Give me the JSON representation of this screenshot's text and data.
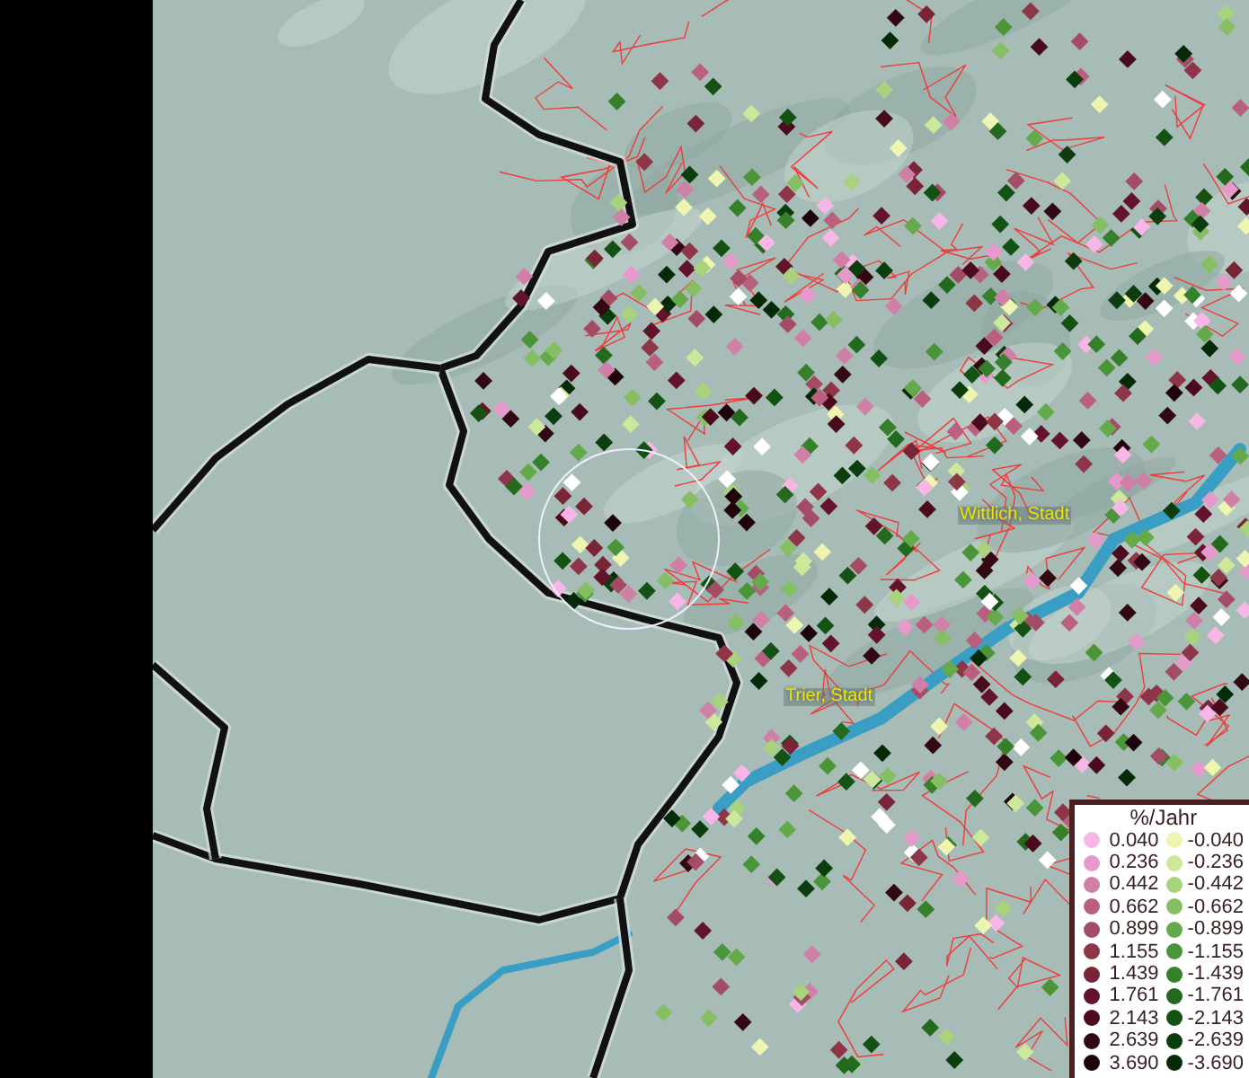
{
  "map": {
    "places": [
      {
        "label": "Wittlich, Stadt",
        "kind": "town"
      },
      {
        "label": "Trier, Stadt",
        "kind": "town"
      }
    ],
    "highlight": {
      "kind": "circle"
    }
  },
  "legend": {
    "title": "%/Jahr",
    "positive": [
      {
        "value": "0.040",
        "color": "#f7b6e6"
      },
      {
        "value": "0.236",
        "color": "#e59acb"
      },
      {
        "value": "0.442",
        "color": "#d07fa6"
      },
      {
        "value": "0.662",
        "color": "#b9607f"
      },
      {
        "value": "0.899",
        "color": "#a44b66"
      },
      {
        "value": "1.155",
        "color": "#8e3548"
      },
      {
        "value": "1.439",
        "color": "#7a2438"
      },
      {
        "value": "1.761",
        "color": "#63142a"
      },
      {
        "value": "2.143",
        "color": "#4a0c1c"
      },
      {
        "value": "2.639",
        "color": "#320812"
      },
      {
        "value": "3.690",
        "color": "#1e040a"
      }
    ],
    "negative": [
      {
        "value": "-0.040",
        "color": "#eef5b0"
      },
      {
        "value": "-0.236",
        "color": "#cde89a"
      },
      {
        "value": "-0.442",
        "color": "#a8d27e"
      },
      {
        "value": "-0.662",
        "color": "#86bf63"
      },
      {
        "value": "-0.899",
        "color": "#64a94a"
      },
      {
        "value": "-1.155",
        "color": "#4a9538"
      },
      {
        "value": "-1.439",
        "color": "#367f2b"
      },
      {
        "value": "-1.761",
        "color": "#236a1e"
      },
      {
        "value": "-2.143",
        "color": "#145214"
      },
      {
        "value": "-2.639",
        "color": "#0b3d0e"
      },
      {
        "value": "-3.690",
        "color": "#052a08"
      }
    ]
  }
}
